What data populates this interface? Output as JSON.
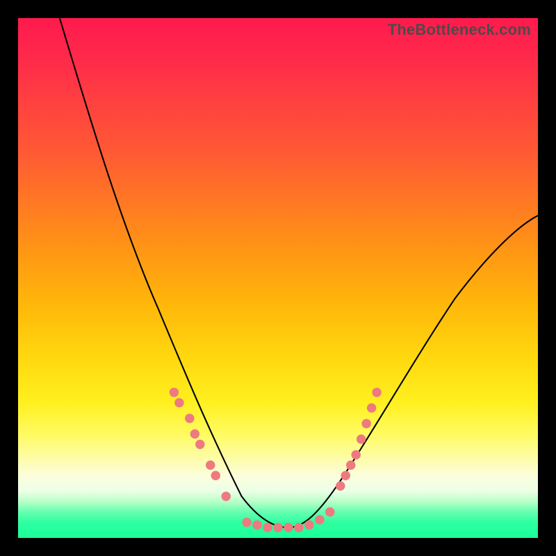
{
  "watermark": "TheBottleneck.com",
  "chart_data": {
    "type": "line",
    "title": "",
    "xlabel": "",
    "ylabel": "",
    "xlim": [
      0,
      100
    ],
    "ylim": [
      0,
      100
    ],
    "grid": false,
    "curve_est_x": [
      8,
      12,
      16,
      20,
      24,
      27,
      30,
      33,
      36,
      39,
      42,
      44,
      46,
      48,
      50,
      52,
      54,
      57,
      60,
      64,
      68,
      73,
      78,
      84,
      90,
      96,
      100
    ],
    "curve_est_y": [
      100,
      88,
      77,
      66,
      55,
      46,
      38,
      31,
      24,
      18,
      12,
      8,
      5,
      3,
      2,
      2,
      3,
      5,
      9,
      15,
      22,
      30,
      38,
      46,
      53,
      59,
      62
    ],
    "marker_clusters": [
      {
        "side": "left",
        "x": [
          30,
          31,
          33,
          34,
          35,
          37,
          38,
          40
        ],
        "y": [
          28,
          26,
          23,
          20,
          18,
          14,
          12,
          8
        ]
      },
      {
        "side": "floor",
        "x": [
          44,
          46,
          48,
          50,
          52,
          54,
          56,
          58,
          60
        ],
        "y": [
          2,
          2,
          2,
          2,
          2,
          2,
          2,
          2,
          2
        ]
      },
      {
        "side": "right",
        "x": [
          62,
          63,
          64,
          65,
          66,
          67,
          68,
          69
        ],
        "y": [
          10,
          12,
          14,
          16,
          19,
          22,
          25,
          28
        ]
      }
    ],
    "marker_color": "#ed7a7f",
    "curve_color": "#000000"
  }
}
